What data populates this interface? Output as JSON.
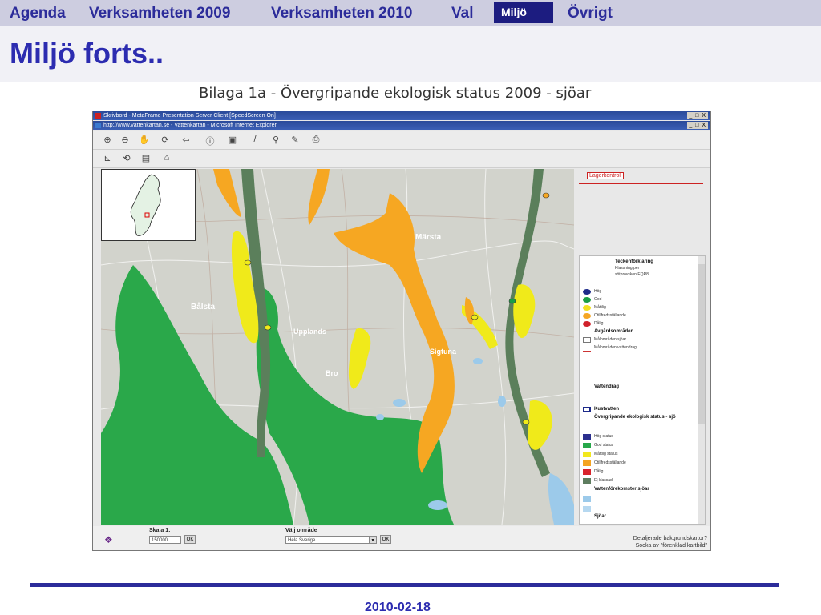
{
  "nav": {
    "items": [
      {
        "label": "Agenda",
        "active": false
      },
      {
        "label": "Verksamheten 2009",
        "active": false
      },
      {
        "label": "Verksamheten 2010",
        "active": false
      },
      {
        "label": "Val",
        "active": false
      },
      {
        "label": "Miljö",
        "active": true
      },
      {
        "label": "Övrigt",
        "active": false
      }
    ]
  },
  "page": {
    "title": "Miljö forts..",
    "subtitle": "Bilaga 1a - Övergripande ekologisk status 2009 - sjöar",
    "footer_date": "2010-02-18"
  },
  "screenshot": {
    "window_title": "Skrivbord - MetaFrame Presentation Server Client [SpeedScreen On]",
    "browser_title": "http://www.vattenkartan.se - Vattenkartan - Microsoft Internet Explorer",
    "window_controls": "_ □ X",
    "lager_button": "Lagerkontroll",
    "legend": {
      "title": "Teckenförklaring",
      "subtitle": "Klassning per",
      "subtitle2": "sötprovsken EQR8",
      "items": [
        {
          "label": "Hög",
          "color": "#1d2a8a"
        },
        {
          "label": "God",
          "color": "#1a9e45"
        },
        {
          "label": "Måttlig",
          "color": "#f0e020"
        },
        {
          "label": "Otillfredsställande",
          "color": "#f5a623"
        },
        {
          "label": "Dålig",
          "color": "#d0202a"
        }
      ],
      "section_avg": "Avgårdsområden",
      "avg_items": [
        "Målområden sjöar",
        "Målområden vattendrag"
      ],
      "section_vattendrag": "Vattendrag",
      "section_kust": "Kustvatten",
      "section_status": "Övergripande ekologisk status - sjö",
      "status_items": [
        {
          "label": "Hög status",
          "color": "#2b2f8e"
        },
        {
          "label": "God status",
          "color": "#27a84a"
        },
        {
          "label": "Måttlig status",
          "color": "#f2e81f"
        },
        {
          "label": "Otillfredsställande",
          "color": "#f4a421"
        },
        {
          "label": "Dålig",
          "color": "#d8242c"
        },
        {
          "label": "Ej klassad",
          "color": "#5e7d5f"
        }
      ],
      "section_vattenforekomster": "Vattenförekomster sjöar",
      "section_sjoar": "Sjöar"
    },
    "bottom": {
      "scale_label": "Skala 1:",
      "scale_value": "150000",
      "ok_label": "OK",
      "area_label": "Välj område",
      "area_value": "Hela Sverige",
      "note_line1": "Detaljerade bakgrundskartor?",
      "note_line2": "Sooka av \"förenklad kartbild\""
    },
    "map_labels": {
      "town1": "Bålsta",
      "town2": "Märsta",
      "town3": "Upplands",
      "town4": "Sigtuna",
      "town5": "Bro"
    },
    "colors": {
      "map_bg": "#d2d3cc",
      "forest": "#2aa84a",
      "orange": "#f6a722",
      "yellow": "#f0ea1a",
      "water": "#9ccaea",
      "dark_green": "#5b7f5b"
    }
  }
}
